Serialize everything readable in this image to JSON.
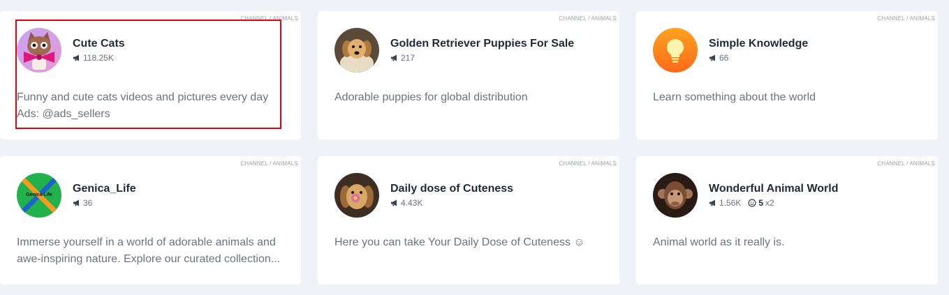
{
  "colors": {
    "background": "#eef1f5",
    "card": "#ffffff",
    "title": "#1f2a37",
    "muted": "#6b7280",
    "highlight": "#e8000b"
  },
  "cards": [
    {
      "category": "CHANNEL / ANIMALS",
      "title": "Cute Cats",
      "avatar_icon": "cat-bowtie-avatar",
      "subscribers": "118.25K",
      "description": "Funny and cute cats videos and pictures every day\nAds: @ads_sellers"
    },
    {
      "category": "CHANNEL / ANIMALS",
      "title": "Golden Retriever Puppies For Sale",
      "avatar_icon": "golden-puppy-avatar",
      "subscribers": "217",
      "description": "Adorable puppies for global distribution"
    },
    {
      "category": "CHANNEL / ANIMALS",
      "title": "Simple Knowledge",
      "avatar_icon": "lightbulb-avatar",
      "subscribers": "66",
      "description": "Learn something about the world"
    },
    {
      "category": "CHANNEL / ANIMALS",
      "title": "Genica_Life",
      "avatar_icon": "dna-avatar",
      "avatar_text": "Genica Life",
      "subscribers": "36",
      "description": "Immerse yourself in a world of adorable animals and awe-inspiring nature. Explore our curated collection..."
    },
    {
      "category": "CHANNEL / ANIMALS",
      "title": "Daily dose of Cuteness",
      "avatar_icon": "dog-with-flower-avatar",
      "subscribers": "4.43K",
      "description": "Here you can take Your Daily Dose of Cuteness ☺"
    },
    {
      "category": "CHANNEL / ANIMALS",
      "title": "Wonderful Animal World",
      "avatar_icon": "monkey-avatar",
      "subscribers": "1.56K",
      "boost_level": "5",
      "boost_mult": "x2",
      "description": "Animal world as it really is."
    }
  ]
}
